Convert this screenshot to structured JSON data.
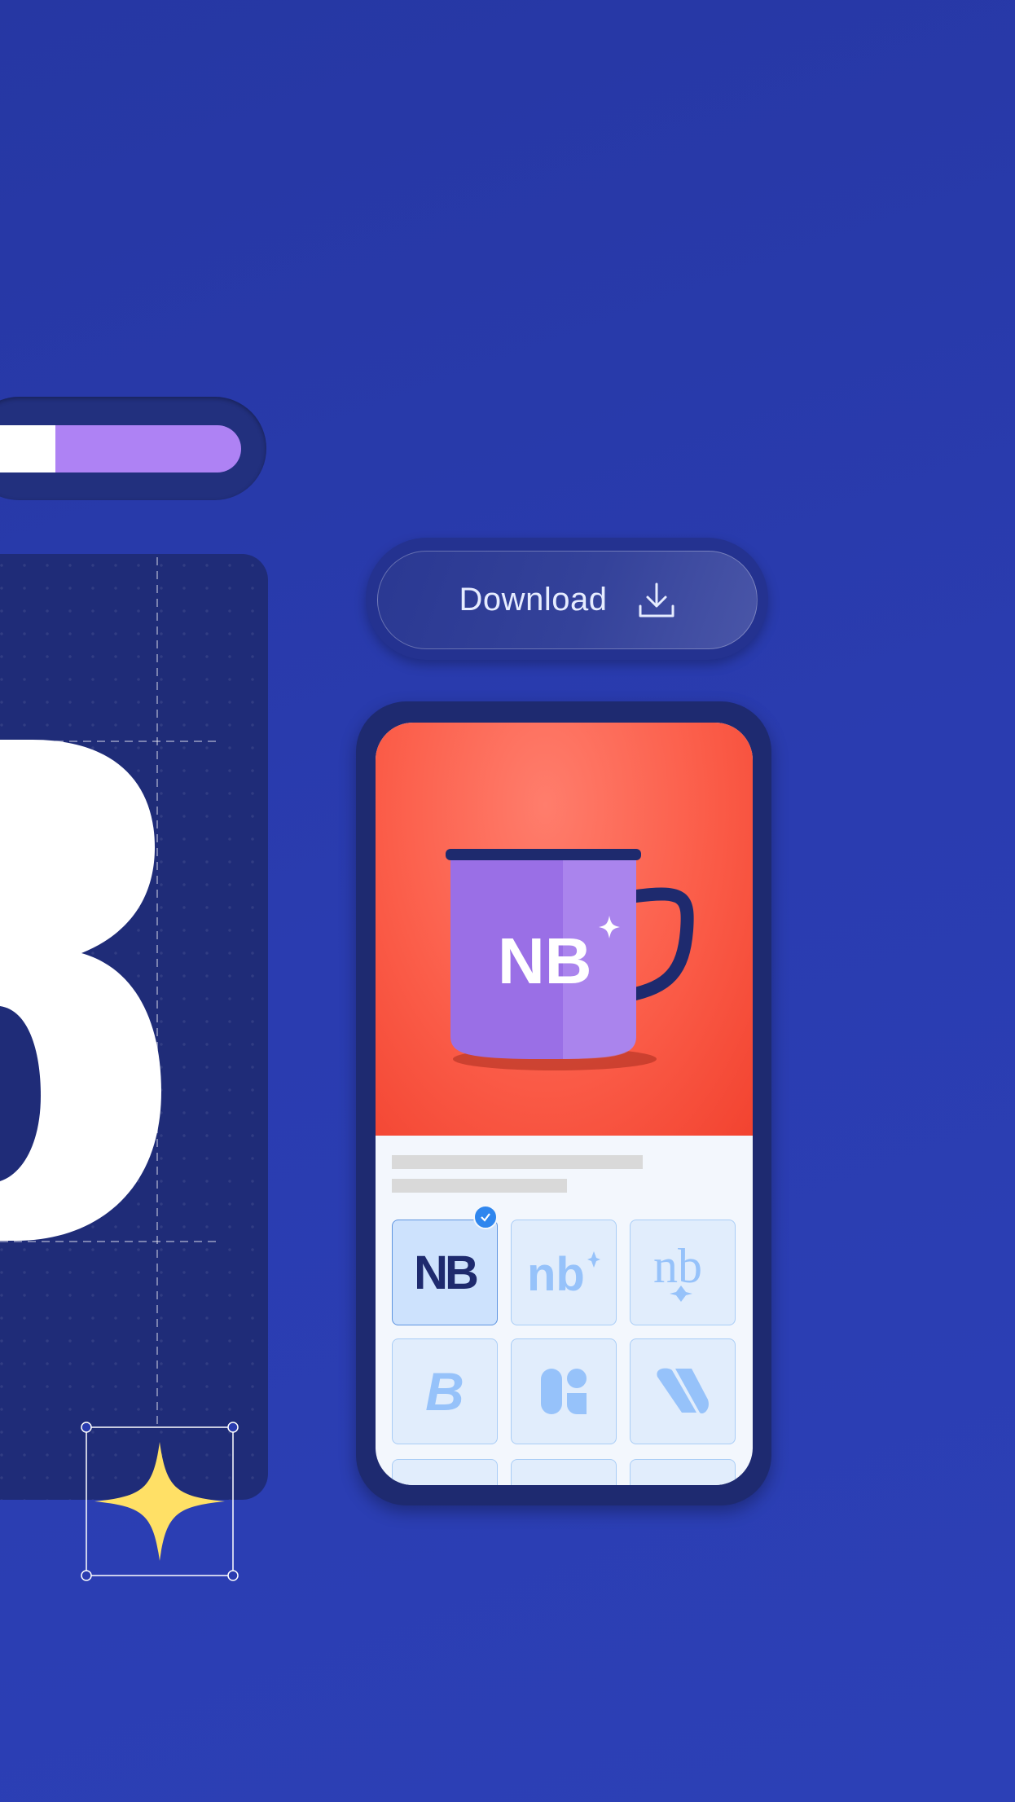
{
  "progress": {
    "value_percent": 82,
    "fill_color": "#ae82f4"
  },
  "download_button": {
    "label": "Download",
    "icon": "download-icon"
  },
  "preview": {
    "mug_logo": "NB",
    "background_color": "#fb5d49",
    "mug_color": "#9a6fe6"
  },
  "logo_options": {
    "selected_index": 0,
    "items": [
      {
        "logo": "NB",
        "selected": true
      },
      {
        "logo": "nb-sparkle",
        "selected": false
      },
      {
        "logo": "nb-serif",
        "selected": false
      },
      {
        "logo": "B-3d",
        "selected": false
      },
      {
        "logo": "ni-rounded",
        "selected": false
      },
      {
        "logo": "N-stripes",
        "selected": false
      },
      {
        "logo": "",
        "selected": false
      },
      {
        "logo": "",
        "selected": false
      },
      {
        "logo": "",
        "selected": false
      }
    ]
  },
  "colors": {
    "background": "#2a3cb0",
    "panel": "#1f2c78",
    "star": "#ffe066",
    "accent": "#2f86ee"
  }
}
